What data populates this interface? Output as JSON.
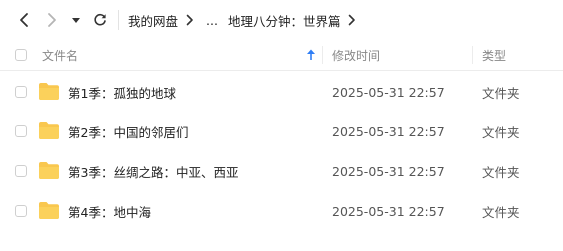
{
  "nav": {
    "back_icon": "chevron-left-icon",
    "forward_icon": "chevron-right-icon",
    "dropdown_icon": "caret-down-icon",
    "refresh_icon": "refresh-icon"
  },
  "breadcrumb": {
    "root": "我的网盘",
    "ellipsis": "...",
    "current": "地理八分钟：世界篇"
  },
  "header": {
    "name": "文件名",
    "modified": "修改时间",
    "type": "类型",
    "sort_icon": "sort-ascending-arrow-icon"
  },
  "colors": {
    "folder": "#F9C74F",
    "sort_arrow": "#2F7EF5"
  },
  "files": [
    {
      "name": "第1季：孤独的地球",
      "modified": "2025-05-31 22:57",
      "type": "文件夹",
      "icon": "folder-icon"
    },
    {
      "name": "第2季：中国的邻居们",
      "modified": "2025-05-31 22:57",
      "type": "文件夹",
      "icon": "folder-icon"
    },
    {
      "name": "第3季：丝绸之路：中亚、西亚",
      "modified": "2025-05-31 22:57",
      "type": "文件夹",
      "icon": "folder-icon"
    },
    {
      "name": "第4季：地中海",
      "modified": "2025-05-31 22:57",
      "type": "文件夹",
      "icon": "folder-icon"
    }
  ]
}
